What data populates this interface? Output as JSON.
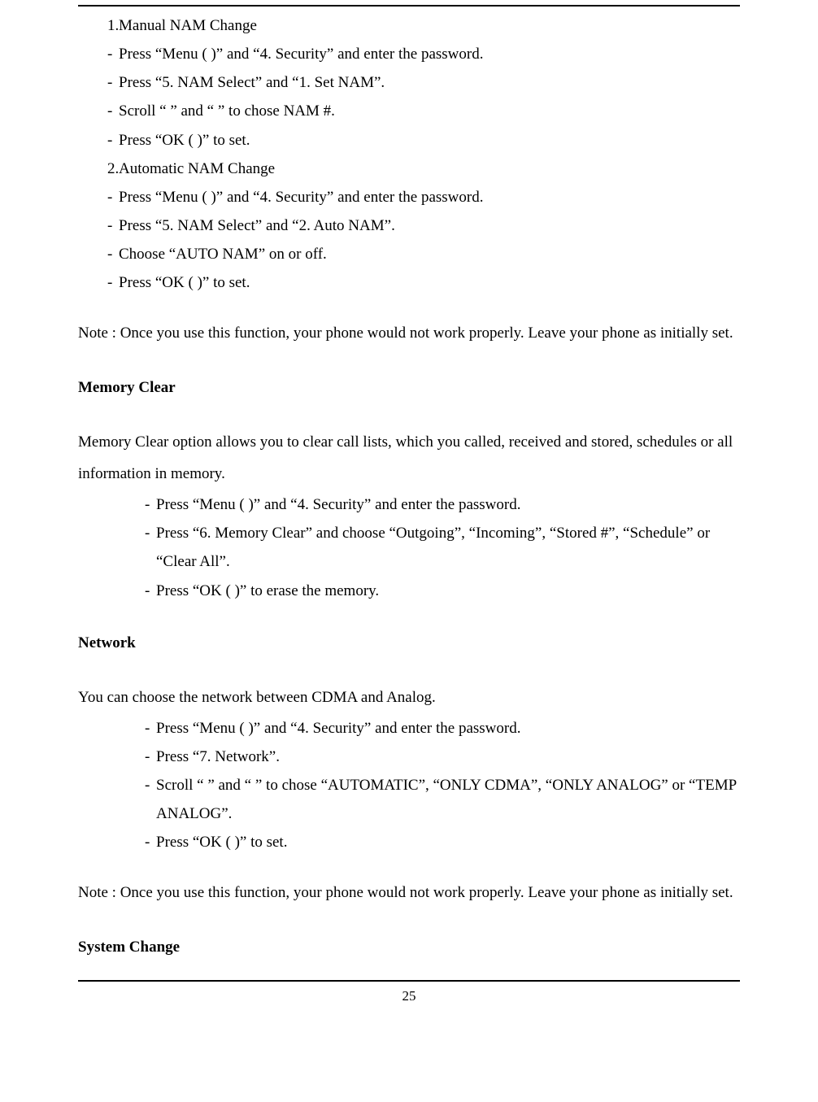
{
  "section_nam": {
    "ordered": [
      {
        "num": "1.",
        "text": "Manual NAM Change"
      },
      null,
      null,
      null,
      null,
      {
        "num": "2.",
        "text": "Automatic NAM Change"
      }
    ],
    "manual_bullets": [
      "Press “Menu (   )” and “4. Security” and enter the password.",
      "Press “5. NAM Select” and “1. Set NAM”.",
      "Scroll “   ” and “   ” to chose NAM #.",
      "Press “OK (   )” to set."
    ],
    "auto_bullets": [
      "Press “Menu (   )” and “4. Security” and enter the password.",
      "Press “5. NAM Select” and “2. Auto NAM”.",
      "Choose “AUTO NAM” on or off.",
      "Press “OK (   )” to set."
    ],
    "note": "Note : Once you use this function, your phone would not work properly. Leave your phone as initially set."
  },
  "section_memory": {
    "heading": "Memory Clear",
    "intro": "Memory Clear option allows you to clear call lists, which you called, received and stored, schedules or all information in memory.",
    "bullets": [
      "Press “Menu (   )” and “4. Security” and enter the password.",
      "Press “6. Memory Clear” and choose “Outgoing”, “Incoming”, “Stored #”, “Schedule” or “Clear All”.",
      "Press “OK (   )” to erase the memory."
    ]
  },
  "section_network": {
    "heading": "Network",
    "intro": "You can choose the network between CDMA and Analog.",
    "bullets": [
      "Press “Menu (   )” and “4. Security” and enter the password.",
      "Press “7. Network”.",
      "Scroll “   ” and “   ” to chose “AUTOMATIC”, “ONLY CDMA”, “ONLY ANALOG” or “TEMP ANALOG”.",
      "Press “OK (   )” to set."
    ],
    "note": "Note : Once you use this function, your phone would not work properly. Leave your phone as initially set."
  },
  "section_system": {
    "heading": "System Change"
  },
  "page_number": "25"
}
